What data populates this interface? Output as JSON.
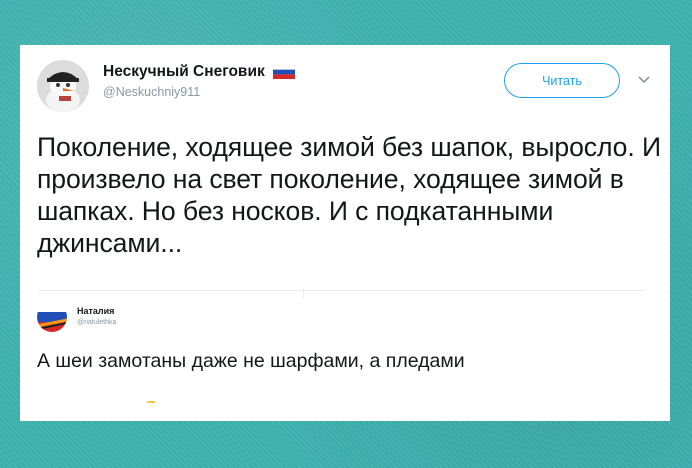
{
  "tweet": {
    "author_name": "Нескучный Снеговик",
    "handle": "@Neskuchniy911",
    "follow_label": "Читать",
    "text": "Поколение, ходящее зимой без шапок, выросло. И произвело на свет поколение, ходящее зимой в шапках. Но без носков. И с подкатанными джинсами..."
  },
  "reply": {
    "author_name": "Наталия",
    "handle": "@natulethka",
    "text": "А шеи замотаны даже не шарфами, а пледами"
  },
  "icons": [
    "avatar-snowman-icon",
    "russian-flag-icon",
    "chevron-down-icon",
    "avatar-flag-icon"
  ],
  "colors": {
    "background": "#3fb3b0",
    "accent": "#1da1f2",
    "text": "#14171a",
    "secondary": "#8899a6"
  }
}
